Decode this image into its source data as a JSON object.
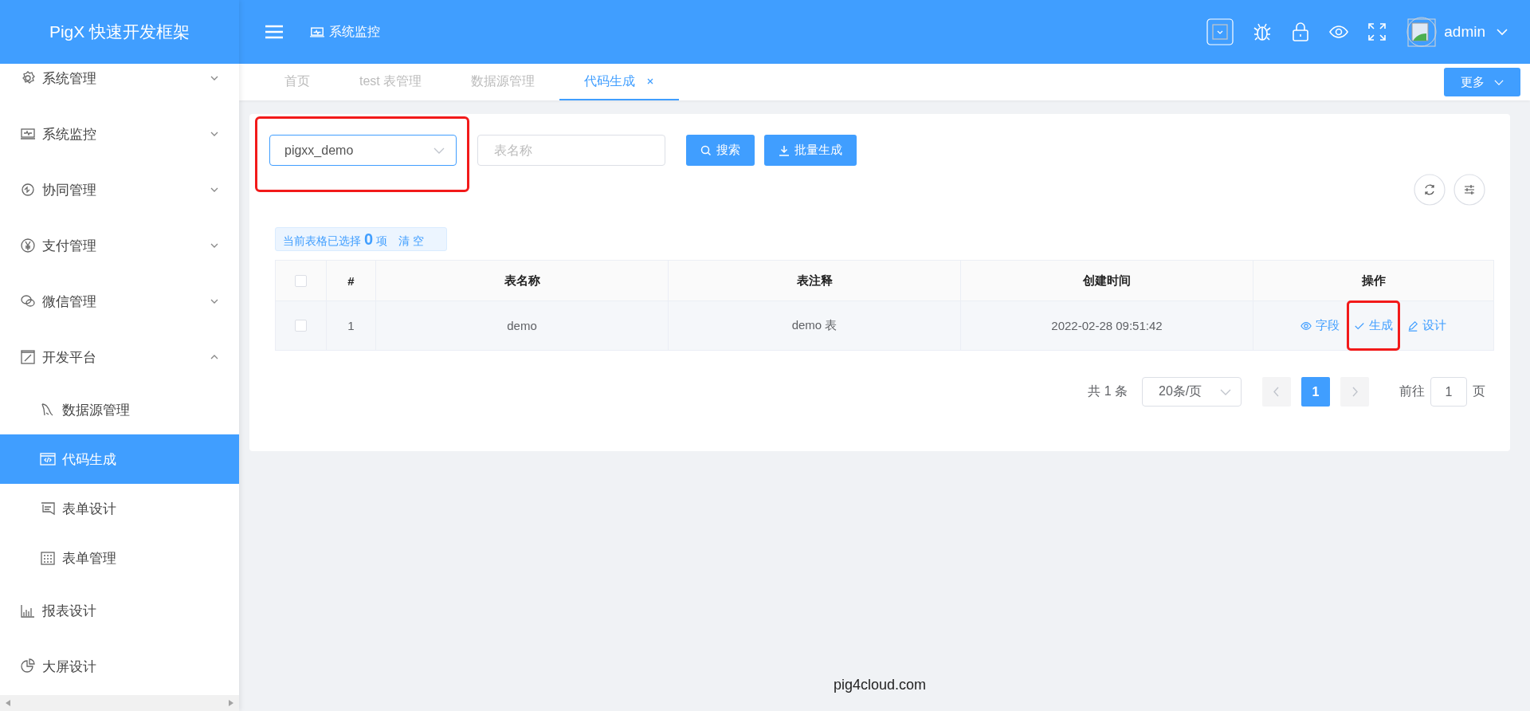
{
  "sidebar": {
    "title": "PigX 快速开发框架",
    "items": [
      {
        "label": "系统管理",
        "kind": "submenu",
        "expanded": false,
        "selected": false
      },
      {
        "label": "系统监控",
        "kind": "submenu",
        "expanded": false,
        "selected": false
      },
      {
        "label": "协同管理",
        "kind": "submenu",
        "expanded": false,
        "selected": false
      },
      {
        "label": "支付管理",
        "kind": "submenu",
        "expanded": false,
        "selected": false
      },
      {
        "label": "微信管理",
        "kind": "submenu",
        "expanded": false,
        "selected": false
      },
      {
        "label": "开发平台",
        "kind": "submenu",
        "expanded": true,
        "selected": false,
        "children": [
          {
            "label": "数据源管理",
            "selected": false
          },
          {
            "label": "代码生成",
            "selected": true
          },
          {
            "label": "表单设计",
            "selected": false
          },
          {
            "label": "表单管理",
            "selected": false
          }
        ]
      },
      {
        "label": "报表设计",
        "kind": "link",
        "selected": false
      },
      {
        "label": "大屏设计",
        "kind": "link",
        "selected": false
      }
    ]
  },
  "header": {
    "breadcrumb": "系统监控",
    "user": "admin"
  },
  "tabs": [
    {
      "label": "首页",
      "selected": false,
      "closable": false
    },
    {
      "label": "test 表管理",
      "selected": false,
      "closable": false
    },
    {
      "label": "数据源管理",
      "selected": false,
      "closable": false
    },
    {
      "label": "代码生成",
      "selected": true,
      "closable": true
    }
  ],
  "more_button": "更多",
  "filters": {
    "datasource": {
      "value": "pigxx_demo",
      "highlighted": true
    },
    "table_name": {
      "placeholder": "表名称"
    },
    "buttons": [
      {
        "label": "搜索",
        "kind": "search"
      },
      {
        "label": "批量生成",
        "kind": "download"
      }
    ]
  },
  "selection_alert": {
    "text": "当前表格已选择 **0** 项",
    "clear": "清 空"
  },
  "table": {
    "all_checked": false,
    "columns": [
      "#",
      "表名称",
      "表注释",
      "创建时间",
      "操作"
    ],
    "rows": [
      {
        "checked": false,
        "index": "1",
        "name": "demo",
        "comment": "demo 表",
        "created": "2022-02-28 09:51:42",
        "actions": [
          {
            "label": "字段",
            "kind": "view",
            "highlighted": false
          },
          {
            "label": "生成",
            "kind": "generate",
            "highlighted": true
          },
          {
            "label": "设计",
            "kind": "edit",
            "highlighted": false
          }
        ]
      }
    ]
  },
  "pagination": {
    "total": "共 1 条",
    "page_size": "20条/页",
    "pages": [
      {
        "label": "1",
        "selected": true
      }
    ],
    "goto_label": "前往",
    "goto_value": "1",
    "goto_suffix": "页"
  },
  "footer": "pig4cloud.com"
}
